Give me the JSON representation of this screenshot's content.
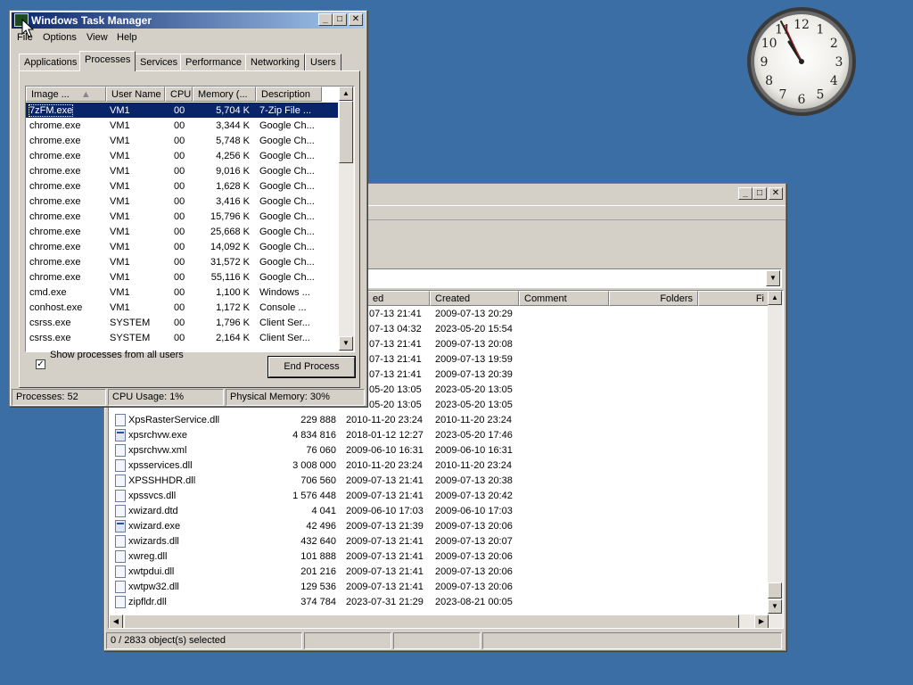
{
  "clock": {
    "time": "11:55",
    "numerals": [
      "12",
      "1",
      "2",
      "3",
      "4",
      "5",
      "6",
      "7",
      "8",
      "9",
      "10",
      "11"
    ]
  },
  "file_manager": {
    "status": {
      "selected": "0 / 2833 object(s) selected"
    },
    "columns": [
      "ed",
      "Created",
      "Comment",
      "Folders",
      "Fi"
    ],
    "top_rows": [
      {
        "modified": "07-13 21:41",
        "created": "2009-07-13 20:29"
      },
      {
        "modified": "07-13 04:32",
        "created": "2023-05-20 15:54"
      },
      {
        "modified": "07-13 21:41",
        "created": "2009-07-13 20:08"
      },
      {
        "modified": "07-13 21:41",
        "created": "2009-07-13 19:59"
      },
      {
        "modified": "07-13 21:41",
        "created": "2009-07-13 20:39"
      },
      {
        "modified": "05-20 13:05",
        "created": "2023-05-20 13:05"
      },
      {
        "modified": "05-20 13:05",
        "created": "2023-05-20 13:05"
      }
    ],
    "files": [
      {
        "name": "XpsRasterService.dll",
        "type": "dll",
        "size": "229 888",
        "modified": "2010-11-20 23:24",
        "created": "2010-11-20 23:24"
      },
      {
        "name": "xpsrchvw.exe",
        "type": "exe",
        "size": "4 834 816",
        "modified": "2018-01-12 12:27",
        "created": "2023-05-20 17:46"
      },
      {
        "name": "xpsrchvw.xml",
        "type": "xml",
        "size": "76 060",
        "modified": "2009-06-10 16:31",
        "created": "2009-06-10 16:31"
      },
      {
        "name": "xpsservices.dll",
        "type": "dll",
        "size": "3 008 000",
        "modified": "2010-11-20 23:24",
        "created": "2010-11-20 23:24"
      },
      {
        "name": "XPSSHHDR.dll",
        "type": "dll",
        "size": "706 560",
        "modified": "2009-07-13 21:41",
        "created": "2009-07-13 20:38"
      },
      {
        "name": "xpssvcs.dll",
        "type": "dll",
        "size": "1 576 448",
        "modified": "2009-07-13 21:41",
        "created": "2009-07-13 20:42"
      },
      {
        "name": "xwizard.dtd",
        "type": "dtd",
        "size": "4 041",
        "modified": "2009-06-10 17:03",
        "created": "2009-06-10 17:03"
      },
      {
        "name": "xwizard.exe",
        "type": "exe",
        "size": "42 496",
        "modified": "2009-07-13 21:39",
        "created": "2009-07-13 20:06"
      },
      {
        "name": "xwizards.dll",
        "type": "dll",
        "size": "432 640",
        "modified": "2009-07-13 21:41",
        "created": "2009-07-13 20:07"
      },
      {
        "name": "xwreg.dll",
        "type": "dll",
        "size": "101 888",
        "modified": "2009-07-13 21:41",
        "created": "2009-07-13 20:06"
      },
      {
        "name": "xwtpdui.dll",
        "type": "dll",
        "size": "201 216",
        "modified": "2009-07-13 21:41",
        "created": "2009-07-13 20:06"
      },
      {
        "name": "xwtpw32.dll",
        "type": "dll",
        "size": "129 536",
        "modified": "2009-07-13 21:41",
        "created": "2009-07-13 20:06"
      },
      {
        "name": "zipfldr.dll",
        "type": "dll",
        "size": "374 784",
        "modified": "2023-07-31 21:29",
        "created": "2023-08-21 00:05"
      }
    ]
  },
  "task_manager": {
    "title": "Windows Task Manager",
    "menu": [
      "File",
      "Options",
      "View",
      "Help"
    ],
    "tabs": [
      "Applications",
      "Processes",
      "Services",
      "Performance",
      "Networking",
      "Users"
    ],
    "active_tab": "Processes",
    "columns": [
      "Image ...",
      "User Name",
      "CPU",
      "Memory (...",
      "Description"
    ],
    "processes": [
      {
        "image": "7zFM.exe",
        "user": "VM1",
        "cpu": "00",
        "memory": "5,704 K",
        "desc": "7-Zip File ...",
        "selected": true
      },
      {
        "image": "chrome.exe",
        "user": "VM1",
        "cpu": "00",
        "memory": "3,344 K",
        "desc": "Google Ch..."
      },
      {
        "image": "chrome.exe",
        "user": "VM1",
        "cpu": "00",
        "memory": "5,748 K",
        "desc": "Google Ch..."
      },
      {
        "image": "chrome.exe",
        "user": "VM1",
        "cpu": "00",
        "memory": "4,256 K",
        "desc": "Google Ch..."
      },
      {
        "image": "chrome.exe",
        "user": "VM1",
        "cpu": "00",
        "memory": "9,016 K",
        "desc": "Google Ch..."
      },
      {
        "image": "chrome.exe",
        "user": "VM1",
        "cpu": "00",
        "memory": "1,628 K",
        "desc": "Google Ch..."
      },
      {
        "image": "chrome.exe",
        "user": "VM1",
        "cpu": "00",
        "memory": "3,416 K",
        "desc": "Google Ch..."
      },
      {
        "image": "chrome.exe",
        "user": "VM1",
        "cpu": "00",
        "memory": "15,796 K",
        "desc": "Google Ch..."
      },
      {
        "image": "chrome.exe",
        "user": "VM1",
        "cpu": "00",
        "memory": "25,668 K",
        "desc": "Google Ch..."
      },
      {
        "image": "chrome.exe",
        "user": "VM1",
        "cpu": "00",
        "memory": "14,092 K",
        "desc": "Google Ch..."
      },
      {
        "image": "chrome.exe",
        "user": "VM1",
        "cpu": "00",
        "memory": "31,572 K",
        "desc": "Google Ch..."
      },
      {
        "image": "chrome.exe",
        "user": "VM1",
        "cpu": "00",
        "memory": "55,116 K",
        "desc": "Google Ch..."
      },
      {
        "image": "cmd.exe",
        "user": "VM1",
        "cpu": "00",
        "memory": "1,100 K",
        "desc": "Windows ..."
      },
      {
        "image": "conhost.exe",
        "user": "VM1",
        "cpu": "00",
        "memory": "1,172 K",
        "desc": "Console ..."
      },
      {
        "image": "csrss.exe",
        "user": "SYSTEM",
        "cpu": "00",
        "memory": "1,796 K",
        "desc": "Client Ser..."
      },
      {
        "image": "csrss.exe",
        "user": "SYSTEM",
        "cpu": "00",
        "memory": "2,164 K",
        "desc": "Client Ser..."
      }
    ],
    "show_all_label": "Show processes from all users",
    "show_all_checked": true,
    "end_process_label": "End Process",
    "status": {
      "processes": "Processes: 52",
      "cpu": "CPU Usage: 1%",
      "memory": "Physical Memory: 30%"
    }
  }
}
